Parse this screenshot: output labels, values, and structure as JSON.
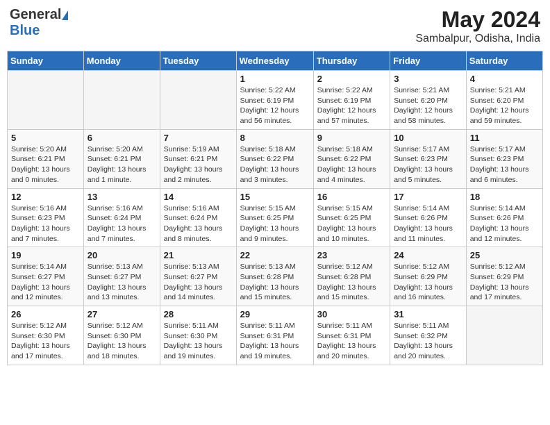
{
  "header": {
    "logo_general": "General",
    "logo_blue": "Blue",
    "title": "May 2024",
    "subtitle": "Sambalpur, Odisha, India"
  },
  "days_of_week": [
    "Sunday",
    "Monday",
    "Tuesday",
    "Wednesday",
    "Thursday",
    "Friday",
    "Saturday"
  ],
  "weeks": [
    [
      {
        "day": "",
        "info": ""
      },
      {
        "day": "",
        "info": ""
      },
      {
        "day": "",
        "info": ""
      },
      {
        "day": "1",
        "info": "Sunrise: 5:22 AM\nSunset: 6:19 PM\nDaylight: 12 hours\nand 56 minutes."
      },
      {
        "day": "2",
        "info": "Sunrise: 5:22 AM\nSunset: 6:19 PM\nDaylight: 12 hours\nand 57 minutes."
      },
      {
        "day": "3",
        "info": "Sunrise: 5:21 AM\nSunset: 6:20 PM\nDaylight: 12 hours\nand 58 minutes."
      },
      {
        "day": "4",
        "info": "Sunrise: 5:21 AM\nSunset: 6:20 PM\nDaylight: 12 hours\nand 59 minutes."
      }
    ],
    [
      {
        "day": "5",
        "info": "Sunrise: 5:20 AM\nSunset: 6:21 PM\nDaylight: 13 hours\nand 0 minutes."
      },
      {
        "day": "6",
        "info": "Sunrise: 5:20 AM\nSunset: 6:21 PM\nDaylight: 13 hours\nand 1 minute."
      },
      {
        "day": "7",
        "info": "Sunrise: 5:19 AM\nSunset: 6:21 PM\nDaylight: 13 hours\nand 2 minutes."
      },
      {
        "day": "8",
        "info": "Sunrise: 5:18 AM\nSunset: 6:22 PM\nDaylight: 13 hours\nand 3 minutes."
      },
      {
        "day": "9",
        "info": "Sunrise: 5:18 AM\nSunset: 6:22 PM\nDaylight: 13 hours\nand 4 minutes."
      },
      {
        "day": "10",
        "info": "Sunrise: 5:17 AM\nSunset: 6:23 PM\nDaylight: 13 hours\nand 5 minutes."
      },
      {
        "day": "11",
        "info": "Sunrise: 5:17 AM\nSunset: 6:23 PM\nDaylight: 13 hours\nand 6 minutes."
      }
    ],
    [
      {
        "day": "12",
        "info": "Sunrise: 5:16 AM\nSunset: 6:23 PM\nDaylight: 13 hours\nand 7 minutes."
      },
      {
        "day": "13",
        "info": "Sunrise: 5:16 AM\nSunset: 6:24 PM\nDaylight: 13 hours\nand 7 minutes."
      },
      {
        "day": "14",
        "info": "Sunrise: 5:16 AM\nSunset: 6:24 PM\nDaylight: 13 hours\nand 8 minutes."
      },
      {
        "day": "15",
        "info": "Sunrise: 5:15 AM\nSunset: 6:25 PM\nDaylight: 13 hours\nand 9 minutes."
      },
      {
        "day": "16",
        "info": "Sunrise: 5:15 AM\nSunset: 6:25 PM\nDaylight: 13 hours\nand 10 minutes."
      },
      {
        "day": "17",
        "info": "Sunrise: 5:14 AM\nSunset: 6:26 PM\nDaylight: 13 hours\nand 11 minutes."
      },
      {
        "day": "18",
        "info": "Sunrise: 5:14 AM\nSunset: 6:26 PM\nDaylight: 13 hours\nand 12 minutes."
      }
    ],
    [
      {
        "day": "19",
        "info": "Sunrise: 5:14 AM\nSunset: 6:27 PM\nDaylight: 13 hours\nand 12 minutes."
      },
      {
        "day": "20",
        "info": "Sunrise: 5:13 AM\nSunset: 6:27 PM\nDaylight: 13 hours\nand 13 minutes."
      },
      {
        "day": "21",
        "info": "Sunrise: 5:13 AM\nSunset: 6:27 PM\nDaylight: 13 hours\nand 14 minutes."
      },
      {
        "day": "22",
        "info": "Sunrise: 5:13 AM\nSunset: 6:28 PM\nDaylight: 13 hours\nand 15 minutes."
      },
      {
        "day": "23",
        "info": "Sunrise: 5:12 AM\nSunset: 6:28 PM\nDaylight: 13 hours\nand 15 minutes."
      },
      {
        "day": "24",
        "info": "Sunrise: 5:12 AM\nSunset: 6:29 PM\nDaylight: 13 hours\nand 16 minutes."
      },
      {
        "day": "25",
        "info": "Sunrise: 5:12 AM\nSunset: 6:29 PM\nDaylight: 13 hours\nand 17 minutes."
      }
    ],
    [
      {
        "day": "26",
        "info": "Sunrise: 5:12 AM\nSunset: 6:30 PM\nDaylight: 13 hours\nand 17 minutes."
      },
      {
        "day": "27",
        "info": "Sunrise: 5:12 AM\nSunset: 6:30 PM\nDaylight: 13 hours\nand 18 minutes."
      },
      {
        "day": "28",
        "info": "Sunrise: 5:11 AM\nSunset: 6:30 PM\nDaylight: 13 hours\nand 19 minutes."
      },
      {
        "day": "29",
        "info": "Sunrise: 5:11 AM\nSunset: 6:31 PM\nDaylight: 13 hours\nand 19 minutes."
      },
      {
        "day": "30",
        "info": "Sunrise: 5:11 AM\nSunset: 6:31 PM\nDaylight: 13 hours\nand 20 minutes."
      },
      {
        "day": "31",
        "info": "Sunrise: 5:11 AM\nSunset: 6:32 PM\nDaylight: 13 hours\nand 20 minutes."
      },
      {
        "day": "",
        "info": ""
      }
    ]
  ]
}
